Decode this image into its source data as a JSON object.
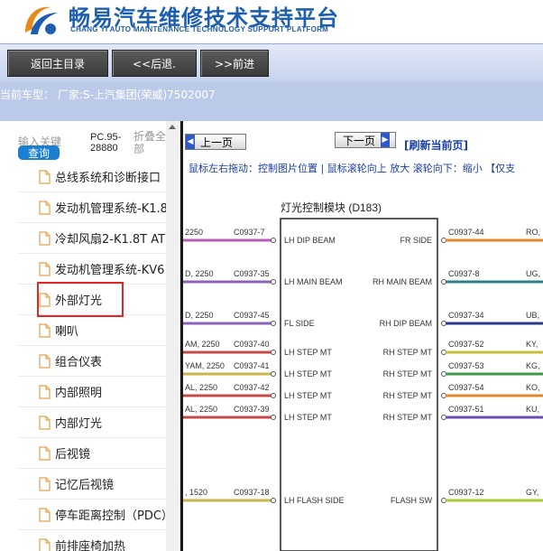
{
  "header": {
    "title_cn": "畅易汽车维修技术支持平台",
    "title_en": "CHANG YI AUTO MAINTENANCE TECHNOLOGY SUPPORT PLATFORM"
  },
  "toolbar": {
    "home_label": "返回主目录",
    "back_label": "<<后退.",
    "forward_label": ">>前进"
  },
  "vehicle": {
    "text": "当前车型： 厂家:S-上汽集团(荣威)7502007"
  },
  "left": {
    "search_label": "输入关键",
    "search_button": "查询",
    "model_code": "PC.95-\n28880",
    "fold_all": "折叠全\n部",
    "tree_items": [
      {
        "label": "总线系统和诊断接口"
      },
      {
        "label": "发动机管理系统-K1.8"
      },
      {
        "label": "冷却风扇2-K1.8T AT"
      },
      {
        "label": "发动机管理系统-KV6"
      },
      {
        "label": "外部灯光"
      },
      {
        "label": "喇叭"
      },
      {
        "label": "组合仪表"
      },
      {
        "label": "内部照明"
      },
      {
        "label": "内部灯光"
      },
      {
        "label": "后视镜"
      },
      {
        "label": "记忆后视镜"
      },
      {
        "label": "停车距离控制（PDC）"
      },
      {
        "label": "前排座椅加热"
      }
    ],
    "selected_index": 4
  },
  "right": {
    "prev_label": "上一页",
    "next_label": "下一页",
    "refresh_label": "[刷新当前页]",
    "hint": "鼠标左右拖动：控制图片位置 | 鼠标滚轮向上 放大  滚轮向下：缩小 【仅支",
    "diagram": {
      "module_title": "灯光控制模块  (D183)",
      "left_wires": [
        {
          "spec": "2250",
          "connector": "C0937-7",
          "color": "#b55fb4"
        },
        {
          "spec": "D, 2250",
          "connector": "C0937-35",
          "color": "#8d63b8"
        },
        {
          "spec": "D, 2250",
          "connector": "C0937-45",
          "color": "#8d63b8"
        },
        {
          "spec": "AM, 2250",
          "connector": "C0937-40",
          "color": "#c44a4a"
        },
        {
          "spec": "YAM, 2250",
          "connector": "C0937-41",
          "color": "#c9b64a"
        },
        {
          "spec": "AL, 2250",
          "connector": "C0937-42",
          "color": "#c44a4a"
        },
        {
          "spec": "AL, 2250",
          "connector": "C0937-39",
          "color": "#c44a4a"
        },
        {
          "spec": ", 1520",
          "connector": "C0937-18",
          "color": "#c9b64a"
        }
      ],
      "left_pins": [
        "LH DIP BEAM",
        "LH MAIN BEAM",
        "FL SIDE",
        "LH STEP MT",
        "LH STEP MT",
        "LH STEP MT",
        "LH STEP MT",
        "LH FLASH SIDE"
      ],
      "right_pins": [
        "FR SIDE",
        "RH MAIN BEAM",
        "RH DIP BEAM",
        "RH STEP MT",
        "RH STEP MT",
        "RH STEP MT",
        "RH STEP MT",
        "FLASH SW"
      ],
      "right_wires": [
        {
          "connector": "C0937-44",
          "spec": "RO,",
          "color": "#e0872f"
        },
        {
          "connector": "C0937-8",
          "spec": "UG,",
          "color": "#2f7f86"
        },
        {
          "connector": "C0937-34",
          "spec": "UB,",
          "color": "#2c3a8a"
        },
        {
          "connector": "C0937-52",
          "spec": "KY,",
          "color": "#c7bf3c"
        },
        {
          "connector": "C0937-53",
          "spec": "KG,",
          "color": "#3f9a4f"
        },
        {
          "connector": "C0937-54",
          "spec": "KO,",
          "color": "#e0872f"
        },
        {
          "connector": "C0937-51",
          "spec": "KU,",
          "color": "#6a4fb0"
        },
        {
          "connector": "C0937-12",
          "spec": "GY,",
          "color": "#a7c93a"
        }
      ]
    }
  }
}
